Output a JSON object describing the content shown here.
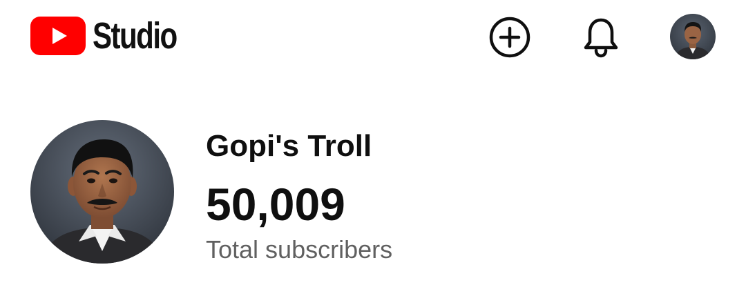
{
  "header": {
    "logo_text": "Studio",
    "brand_color": "#ff0000",
    "icons": {
      "logo": "youtube-play-icon",
      "create": "plus-circle-icon",
      "notifications": "bell-icon",
      "account": "avatar"
    }
  },
  "channel": {
    "name": "Gopi's Troll",
    "subscriber_count": "50,009",
    "subscriber_label": "Total subscribers"
  }
}
